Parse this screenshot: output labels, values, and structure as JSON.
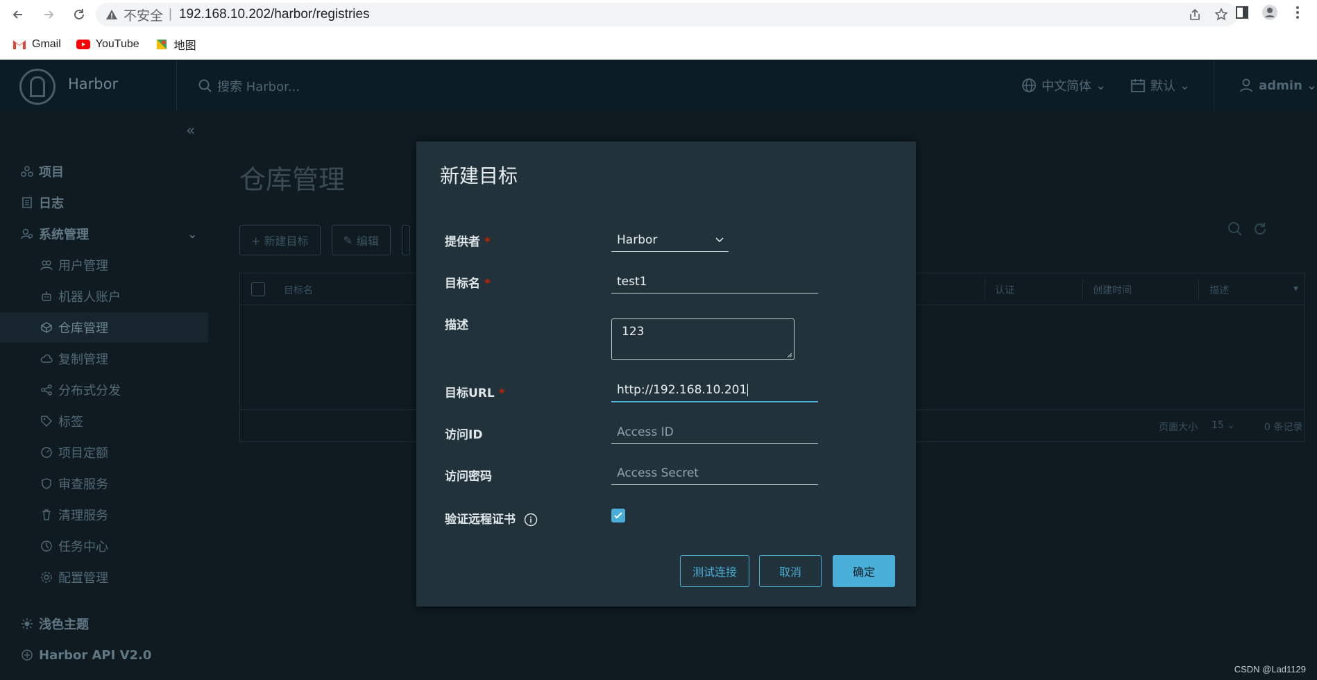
{
  "browser": {
    "insecure_label": "不安全",
    "separator": "|",
    "url": "192.168.10.202/harbor/registries",
    "bookmarks": [
      {
        "label": "Gmail"
      },
      {
        "label": "YouTube"
      },
      {
        "label": "地图"
      }
    ]
  },
  "header": {
    "app_title": "Harbor",
    "search_placeholder": "搜索 Harbor...",
    "language": "中文简体",
    "datetime_format": "默认",
    "user": "admin"
  },
  "sidebar": {
    "collapse_glyph": "«",
    "items": [
      {
        "label": "项目",
        "level": "top"
      },
      {
        "label": "日志",
        "level": "top"
      },
      {
        "label": "系统管理",
        "level": "top"
      },
      {
        "label": "用户管理",
        "level": "sub"
      },
      {
        "label": "机器人账户",
        "level": "sub"
      },
      {
        "label": "仓库管理",
        "level": "sub",
        "active": true
      },
      {
        "label": "复制管理",
        "level": "sub"
      },
      {
        "label": "分布式分发",
        "level": "sub"
      },
      {
        "label": "标签",
        "level": "sub"
      },
      {
        "label": "项目定额",
        "level": "sub"
      },
      {
        "label": "审查服务",
        "level": "sub"
      },
      {
        "label": "清理服务",
        "level": "sub"
      },
      {
        "label": "任务中心",
        "level": "sub"
      },
      {
        "label": "配置管理",
        "level": "sub"
      },
      {
        "label": "浅色主题",
        "level": "top"
      },
      {
        "label": "Harbor API V2.0",
        "level": "top"
      }
    ]
  },
  "main": {
    "page_title": "仓库管理",
    "toolbar": {
      "new_target": "+ 新建目标",
      "edit": "编辑"
    },
    "grid": {
      "columns": [
        "目标名",
        "认证",
        "创建时间",
        "描述"
      ],
      "page_size_label": "页面大小",
      "page_size_value": "15",
      "record_count": "0 条记录"
    }
  },
  "modal": {
    "title": "新建目标",
    "fields": {
      "provider": {
        "label": "提供者",
        "value": "Harbor",
        "required": true
      },
      "name": {
        "label": "目标名",
        "value": "test1",
        "required": true
      },
      "description": {
        "label": "描述",
        "value": "123"
      },
      "url": {
        "label": "目标URL",
        "value": "http://192.168.10.201",
        "required": true
      },
      "access_id": {
        "label": "访问ID",
        "placeholder": "Access ID"
      },
      "access_secret": {
        "label": "访问密码",
        "placeholder": "Access Secret"
      },
      "verify_cert": {
        "label": "验证远程证书",
        "checked": true
      }
    },
    "required_mark": "*",
    "buttons": {
      "test": "测试连接",
      "cancel": "取消",
      "ok": "确定"
    }
  },
  "watermark": "CSDN @Lad1129",
  "colors": {
    "accent": "#49afd9",
    "required": "#c92100",
    "modal_bg": "#21323a",
    "page_bg": "#0f1b21"
  }
}
